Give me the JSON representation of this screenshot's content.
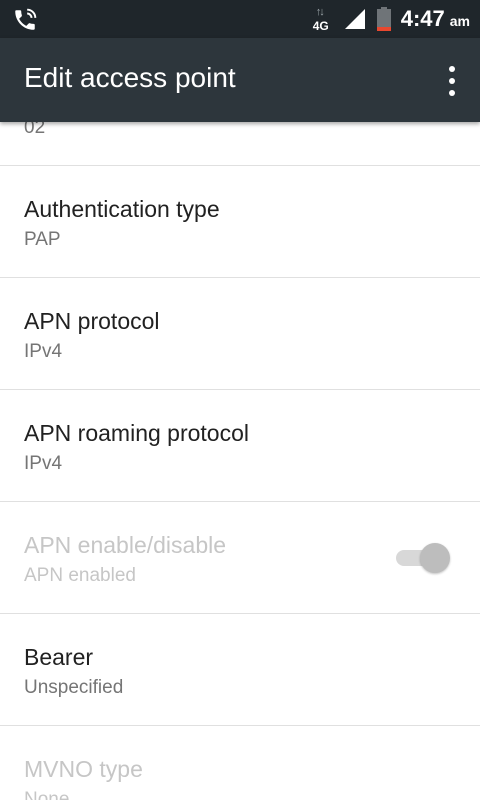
{
  "status_bar": {
    "network_type": "4G",
    "time": "4:47",
    "ampm": "am",
    "icons": [
      "phone-call-icon",
      "data-arrows-icon",
      "signal-icon",
      "battery-low-icon"
    ],
    "battery_level_color": "#e8482f"
  },
  "app_bar": {
    "title": "Edit access point",
    "menu_icon": "more-vert-icon"
  },
  "list": {
    "partial_top_value": "02",
    "items": [
      {
        "title": "Authentication type",
        "summary": "PAP",
        "enabled": true
      },
      {
        "title": "APN protocol",
        "summary": "IPv4",
        "enabled": true
      },
      {
        "title": "APN roaming protocol",
        "summary": "IPv4",
        "enabled": true
      },
      {
        "title": "APN enable/disable",
        "summary": "APN enabled",
        "enabled": false,
        "toggle_on": true
      },
      {
        "title": "Bearer",
        "summary": "Unspecified",
        "enabled": true
      },
      {
        "title": "MVNO type",
        "summary": "None",
        "enabled": false
      }
    ]
  },
  "colors": {
    "status_bar_bg": "#1f262b",
    "app_bar_bg": "#2d363c",
    "title_text": "#212121",
    "summary_text": "#757575",
    "disabled_text": "#c6c6c6"
  }
}
